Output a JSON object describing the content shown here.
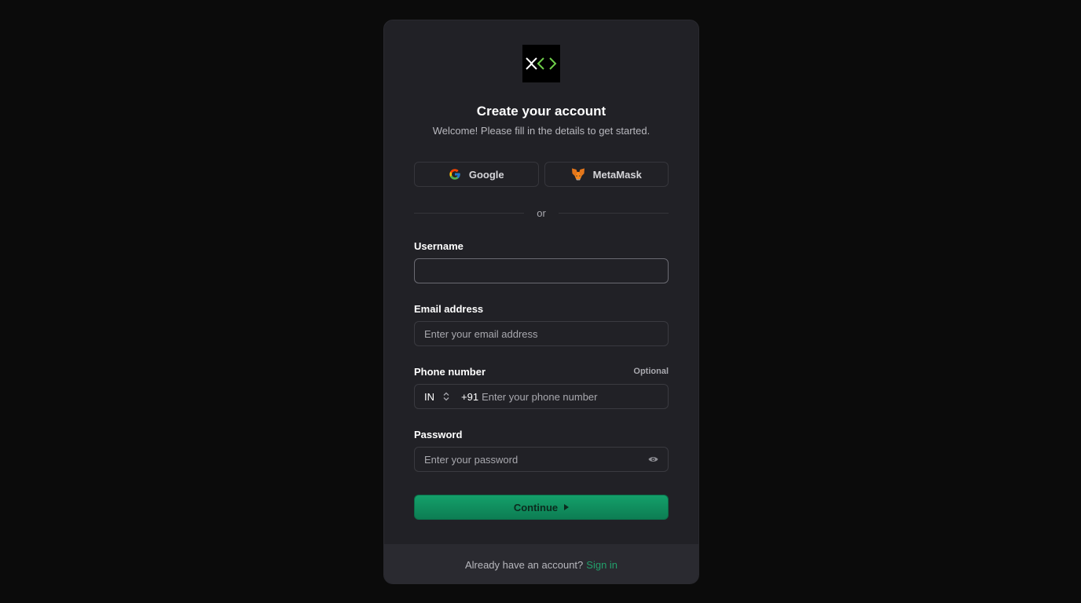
{
  "card": {
    "title": "Create your account",
    "subtitle": "Welcome! Please fill in the details to get started."
  },
  "social": {
    "google_label": "Google",
    "metamask_label": "MetaMask"
  },
  "divider_text": "or",
  "fields": {
    "username": {
      "label": "Username",
      "value": "",
      "placeholder": ""
    },
    "email": {
      "label": "Email address",
      "placeholder": "Enter your email address"
    },
    "phone": {
      "label": "Phone number",
      "optional_label": "Optional",
      "country": "IN",
      "dial_code": "+91",
      "placeholder": "Enter your phone number"
    },
    "password": {
      "label": "Password",
      "placeholder": "Enter your password"
    }
  },
  "continue_label": "Continue",
  "footer": {
    "text": "Already have an account?",
    "link": "Sign in"
  },
  "icons": {
    "logo": "code-brackets-logo",
    "google": "google-icon",
    "metamask": "metamask-fox-icon",
    "country_select": "chevron-updown-icon",
    "password_toggle": "eye-icon",
    "continue_arrow": "triangle-right-icon"
  },
  "colors": {
    "background": "#0b0b0b",
    "card": "#212126",
    "footer": "#2a2a30",
    "accent": "#22a06b",
    "button": "#14a06a"
  }
}
